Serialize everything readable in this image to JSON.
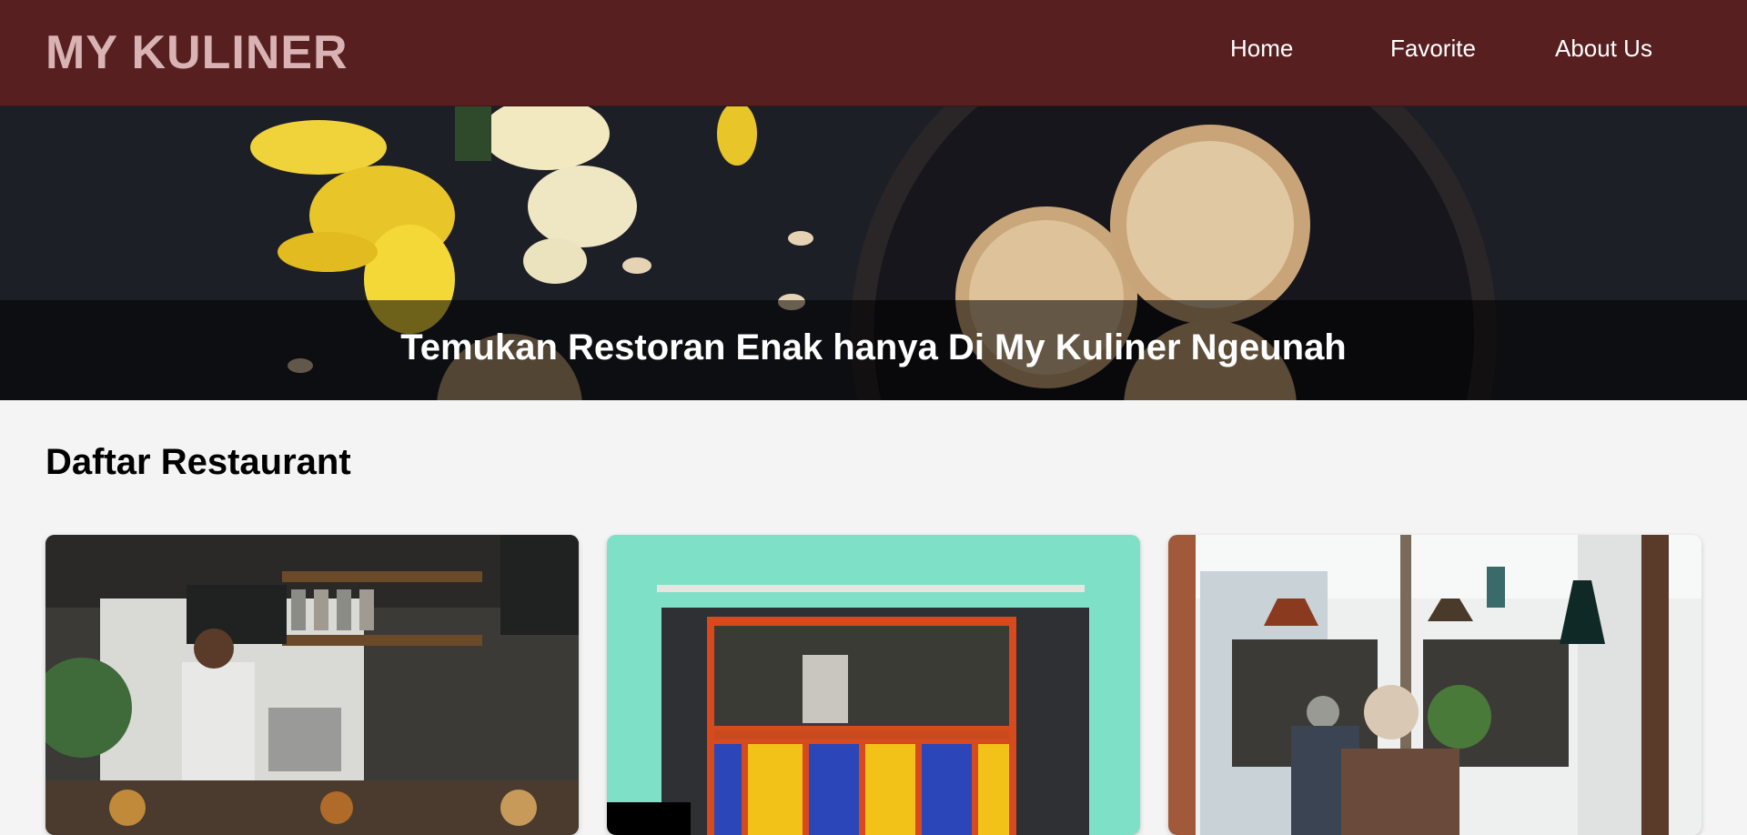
{
  "header": {
    "brand": "MY KULINER",
    "nav": [
      {
        "label": "Home"
      },
      {
        "label": "Favorite"
      },
      {
        "label": "About Us"
      }
    ]
  },
  "hero": {
    "tagline": "Temukan Restoran Enak hanya Di My Kuliner Ngeunah",
    "image": "cookies-and-daffodils-photo"
  },
  "main": {
    "section_title": "Daftar Restaurant",
    "restaurants": [
      {
        "image": "cafe-kitchen-photo"
      },
      {
        "image": "green-storefront-photo"
      },
      {
        "image": "cafe-interior-lamps-photo"
      }
    ]
  },
  "colors": {
    "header_bg": "#571f20",
    "brand_text": "#d9b3b3",
    "page_bg": "#f4f4f4"
  }
}
